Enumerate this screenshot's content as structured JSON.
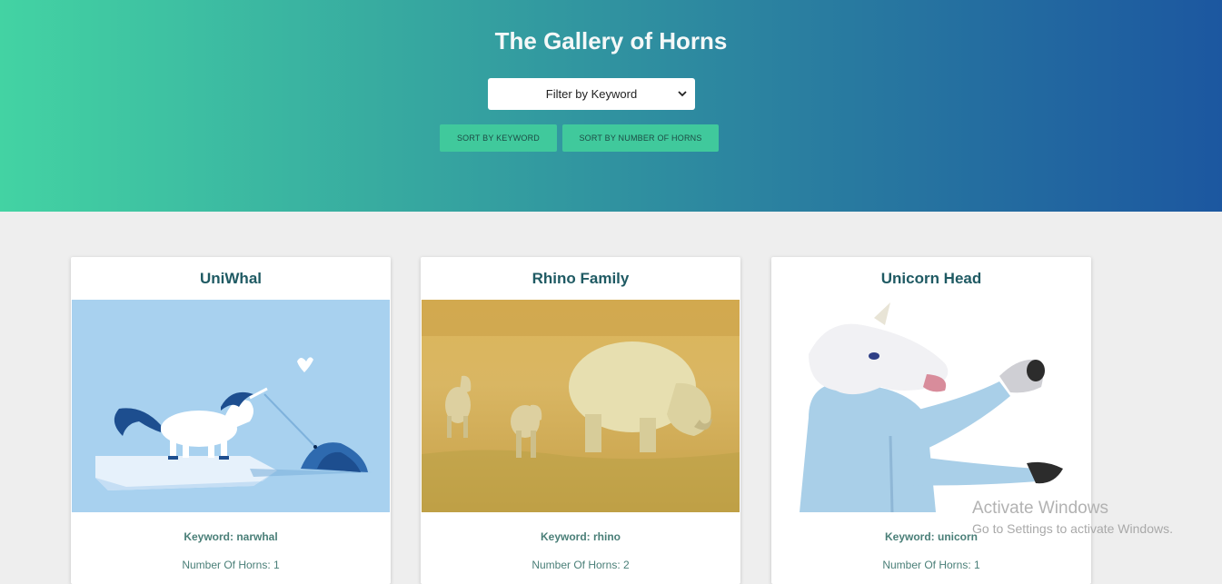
{
  "header": {
    "title": "The Gallery of Horns",
    "filter_select": "Filter by Keyword",
    "sort_by_keyword": "SORT BY KEYWORD",
    "sort_by_horns": "SORT BY NUMBER OF HORNS",
    "accent_color": "#40c99c"
  },
  "cards": [
    {
      "title": "UniWhal",
      "keyword": "Keyword: narwhal",
      "horns": "Number Of Horns: 1",
      "image": "unicorn-and-narwhal-illustration"
    },
    {
      "title": "Rhino Family",
      "keyword": "Keyword: rhino",
      "horns": "Number Of Horns: 2",
      "image": "rhino-family-photo"
    },
    {
      "title": "Unicorn Head",
      "keyword": "Keyword: unicorn",
      "horns": "Number Of Horns: 1",
      "image": "unicorn-mask-person-photo"
    }
  ],
  "watermark": {
    "title": "Activate Windows",
    "subtitle": "Go to Settings to activate Windows."
  }
}
